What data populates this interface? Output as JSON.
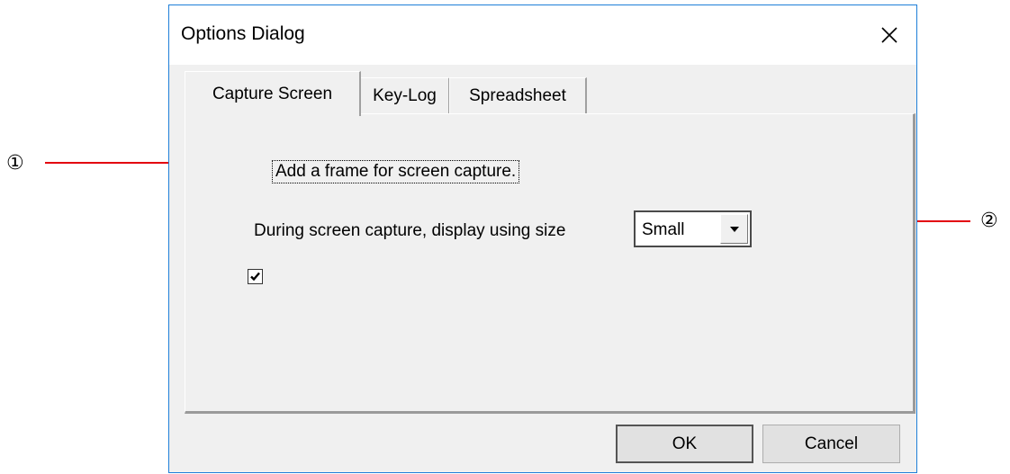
{
  "callouts": {
    "one": "①",
    "two": "②"
  },
  "colors": {
    "leader": "#e3000f",
    "window_border": "#1e7fd8",
    "face": "#f0f0f0"
  },
  "dialog": {
    "title": "Options Dialog",
    "close_icon": "close-icon"
  },
  "tabs": [
    {
      "label": "Capture Screen",
      "active": true
    },
    {
      "label": "Key-Log",
      "active": false
    },
    {
      "label": "Spreadsheet",
      "active": false
    }
  ],
  "capture": {
    "frame_checkbox_label": "Add a frame for screen capture.",
    "frame_checked": true,
    "size_label": "During screen capture, display using size",
    "size_selected": "Small",
    "dropdown_icon": "chevron-down-icon"
  },
  "buttons": {
    "ok": "OK",
    "cancel": "Cancel"
  }
}
